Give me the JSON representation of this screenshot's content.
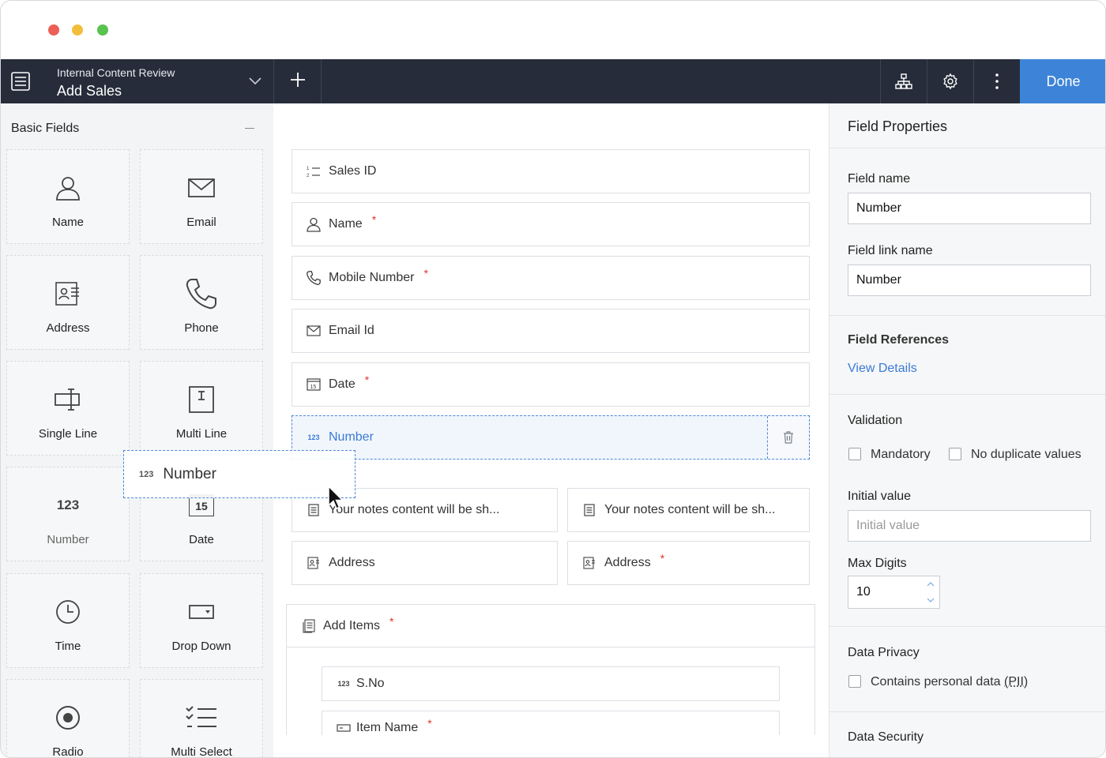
{
  "app": {
    "name": "Internal Content Review",
    "form": "Add Sales"
  },
  "toolbar": {
    "done_label": "Done"
  },
  "left_panel": {
    "title": "Basic Fields",
    "tiles": [
      {
        "label": "Name",
        "icon": "person-icon"
      },
      {
        "label": "Email",
        "icon": "envelope-icon"
      },
      {
        "label": "Address",
        "icon": "address-card-icon"
      },
      {
        "label": "Phone",
        "icon": "phone-icon"
      },
      {
        "label": "Single Line",
        "icon": "single-line-icon"
      },
      {
        "label": "Multi Line",
        "icon": "multi-line-icon"
      },
      {
        "label": "Number",
        "icon": "number-icon",
        "icon_text": "123"
      },
      {
        "label": "Date",
        "icon": "calendar-icon",
        "icon_text": "15"
      },
      {
        "label": "Time",
        "icon": "clock-icon"
      },
      {
        "label": "Drop Down",
        "icon": "dropdown-icon"
      },
      {
        "label": "Radio",
        "icon": "radio-icon"
      },
      {
        "label": "Multi Select",
        "icon": "checklist-icon"
      }
    ]
  },
  "form": {
    "fields": [
      {
        "label": "Sales ID",
        "icon": "list-numbered-icon"
      },
      {
        "label": "Name",
        "icon": "person-icon",
        "required": "*"
      },
      {
        "label": "Mobile Number",
        "icon": "phone-icon",
        "required": "*"
      },
      {
        "label": "Email Id",
        "icon": "envelope-icon"
      },
      {
        "label": "Date",
        "icon": "calendar-icon",
        "required": "*"
      },
      {
        "label": "Number",
        "icon": "number-icon",
        "icon_text": "123",
        "selected": true
      }
    ],
    "notes": [
      "Your notes content will be sh...",
      "Your notes content will be sh..."
    ],
    "addresses": [
      {
        "label": "Address"
      },
      {
        "label": "Address",
        "required": "*"
      }
    ],
    "subform": {
      "label": "Add Items",
      "required": "*",
      "fields": [
        {
          "label": "S.No",
          "icon_text": "123"
        },
        {
          "label": "Item Name",
          "required": "*"
        }
      ]
    }
  },
  "drag_ghost": {
    "icon_text": "123",
    "label": "Number"
  },
  "properties": {
    "title": "Field Properties",
    "field_name_label": "Field name",
    "field_name_value": "Number",
    "field_link_label": "Field link name",
    "field_link_value": "Number",
    "references_label": "Field References",
    "references_link": "View Details",
    "validation_label": "Validation",
    "mandatory_label": "Mandatory",
    "no_duplicate_label": "No duplicate values",
    "initial_value_label": "Initial value",
    "initial_value_placeholder": "Initial value",
    "max_digits_label": "Max Digits",
    "max_digits_value": "10",
    "privacy_label": "Data Privacy",
    "pii_label": "Contains personal data",
    "pii_abbr": "(PII)",
    "security_label": "Data Security"
  },
  "colors": {
    "toolbar": "#262c3a",
    "accent": "#3d84d8",
    "required": "#e0342b"
  }
}
